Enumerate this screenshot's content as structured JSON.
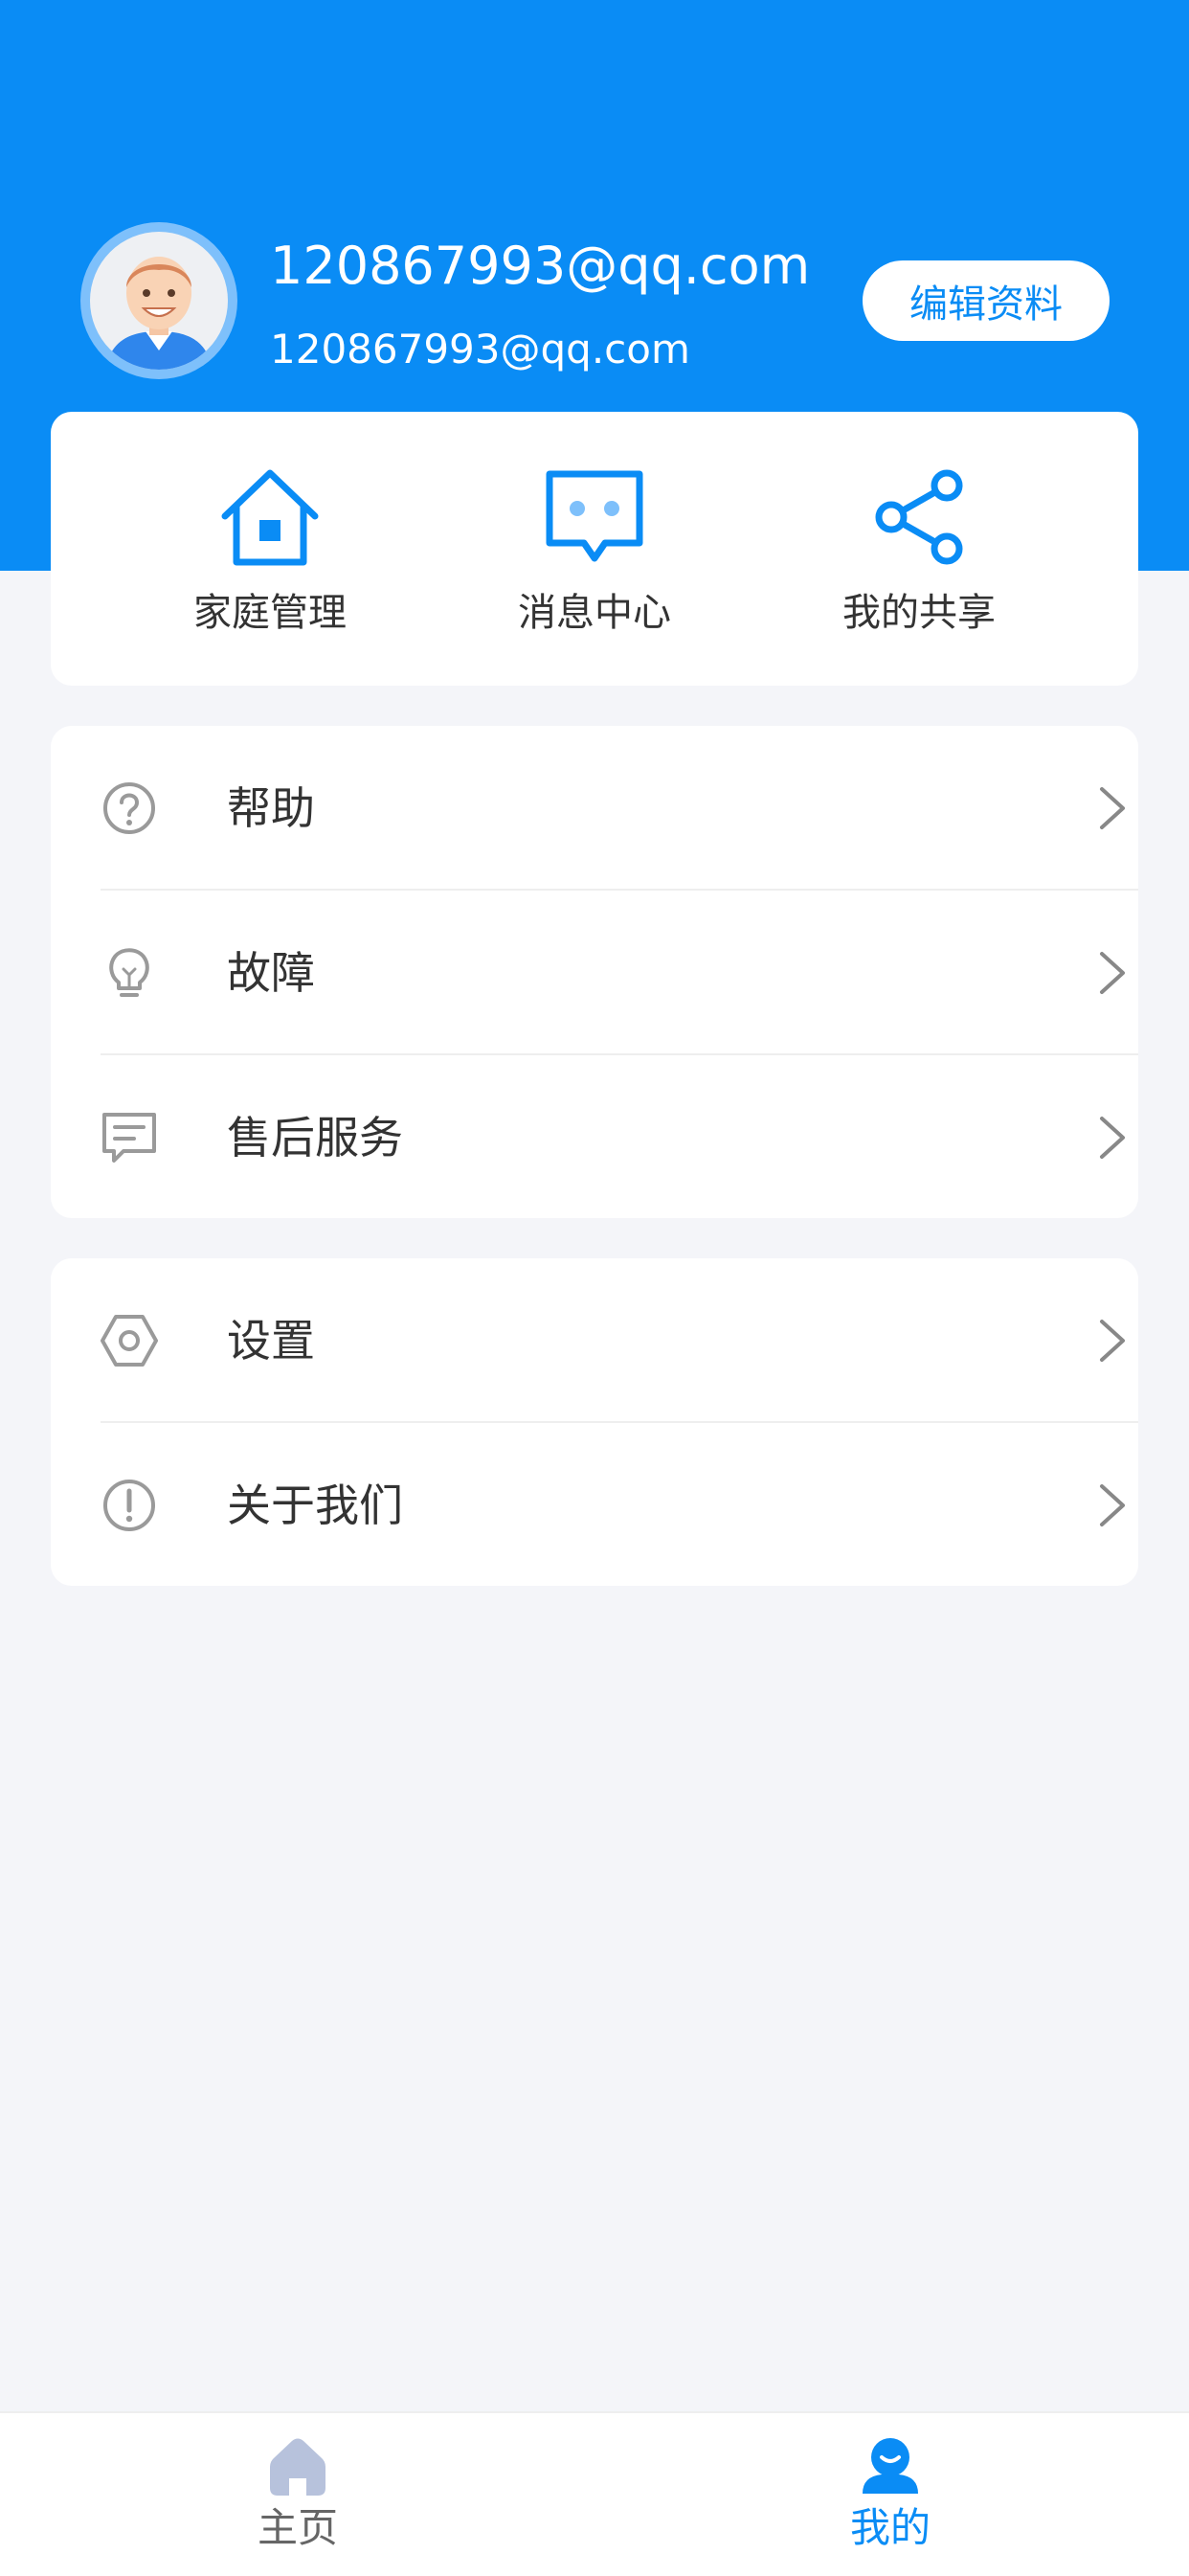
{
  "header": {
    "user_name": "120867993@qq.com",
    "user_sub": "120867993@qq.com",
    "edit_button": "编辑资料"
  },
  "quick_actions": [
    {
      "label": "家庭管理",
      "icon": "house-icon"
    },
    {
      "label": "消息中心",
      "icon": "message-bubble-icon"
    },
    {
      "label": "我的共享",
      "icon": "share-icon"
    }
  ],
  "menu_group_1": [
    {
      "label": "帮助",
      "icon": "question-circle-icon"
    },
    {
      "label": "故障",
      "icon": "lightbulb-icon"
    },
    {
      "label": "售后服务",
      "icon": "chat-lines-icon"
    }
  ],
  "menu_group_2": [
    {
      "label": "设置",
      "icon": "hexagon-settings-icon"
    },
    {
      "label": "关于我们",
      "icon": "exclamation-circle-icon"
    }
  ],
  "tabbar": {
    "tabs": [
      {
        "label": "主页",
        "icon": "home-icon",
        "active": false
      },
      {
        "label": "我的",
        "icon": "profile-icon",
        "active": true
      }
    ]
  },
  "colors": {
    "primary": "#0a8cf5",
    "background": "#f4f5f9",
    "inactive_tab": "#b7c2dc",
    "text": "#333333",
    "icon_gray": "#9a9a9a"
  }
}
